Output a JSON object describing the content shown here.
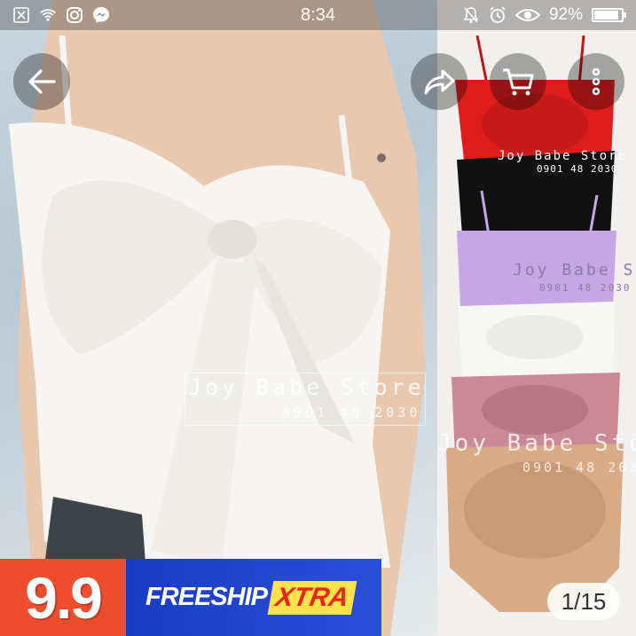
{
  "status_bar": {
    "time": "8:34",
    "battery_percent": "92%",
    "battery_level": 0.92,
    "left_icons": [
      "notification-close-icon",
      "wifi-icon",
      "instagram-icon",
      "messenger-icon"
    ],
    "right_icons": [
      "bell-muted-icon",
      "alarm-icon",
      "eye-icon",
      "battery-icon"
    ]
  },
  "toolbar": {
    "back_icon": "back-arrow-icon",
    "share_icon": "share-icon",
    "cart_icon": "cart-icon",
    "more_icon": "more-vertical-icon"
  },
  "image": {
    "watermark_main": "Joy Babe Store",
    "watermark_phone": "0901 48 2030",
    "garment_colors": [
      "#e01d1d",
      "#111111",
      "#c7a6e6",
      "#f7f7f5",
      "#c98a96",
      "#d8ab86"
    ],
    "counter": "1/15"
  },
  "promo": {
    "number": "9.9",
    "freeship": "FREESHIP",
    "xtra": "XTRA",
    "colors": {
      "orange": "#ee4d2d",
      "blue": "#1a3cc4",
      "yellow": "#ffe24a",
      "red": "#e8271c"
    }
  }
}
